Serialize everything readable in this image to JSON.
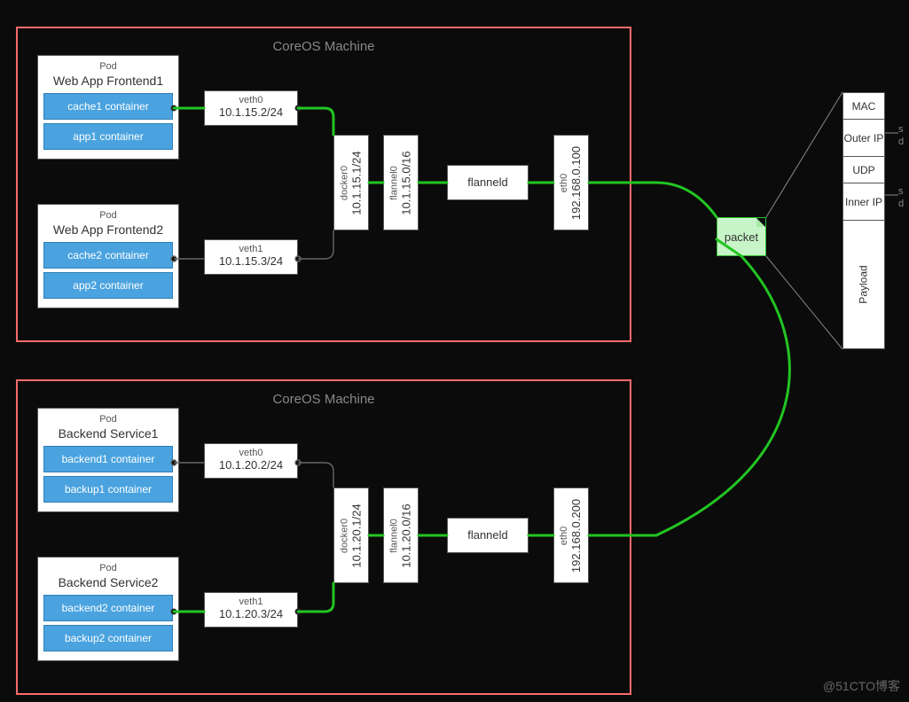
{
  "watermark": "@51CTO博客",
  "edge_labels": {
    "srcdst_top": "s",
    "srcdst_top2": "d",
    "srcdst_bot": "s",
    "srcdst_bot2": "d"
  },
  "machines": [
    {
      "title": "CoreOS Machine",
      "pods": [
        {
          "label": "Pod",
          "title": "Web App Frontend1",
          "containers": [
            "cache1 container",
            "app1 container"
          ]
        },
        {
          "label": "Pod",
          "title": "Web App Frontend2",
          "containers": [
            "cache2 container",
            "app2 container"
          ]
        }
      ],
      "veth": [
        {
          "name": "veth0",
          "ip": "10.1.15.2/24"
        },
        {
          "name": "veth1",
          "ip": "10.1.15.3/24"
        }
      ],
      "docker0": {
        "name": "docker0",
        "ip": "10.1.15.1/24"
      },
      "flannel0": {
        "name": "flannel0",
        "ip": "10.1.15.0/16"
      },
      "flanneld": "flanneld",
      "eth0": {
        "name": "eth0",
        "ip": "192.168.0.100"
      }
    },
    {
      "title": "CoreOS Machine",
      "pods": [
        {
          "label": "Pod",
          "title": "Backend Service1",
          "containers": [
            "backend1 container",
            "backup1 container"
          ]
        },
        {
          "label": "Pod",
          "title": "Backend Service2",
          "containers": [
            "backend2 container",
            "backup2 container"
          ]
        }
      ],
      "veth": [
        {
          "name": "veth0",
          "ip": "10.1.20.2/24"
        },
        {
          "name": "veth1",
          "ip": "10.1.20.3/24"
        }
      ],
      "docker0": {
        "name": "docker0",
        "ip": "10.1.20.1/24"
      },
      "flannel0": {
        "name": "flannel0",
        "ip": "10.1.20.0/16"
      },
      "flanneld": "flanneld",
      "eth0": {
        "name": "eth0",
        "ip": "192.168.0.200"
      }
    }
  ],
  "packet_label": "packet",
  "stack": [
    "MAC",
    "Outer IP",
    "UDP",
    "Inner IP",
    "Payload"
  ]
}
